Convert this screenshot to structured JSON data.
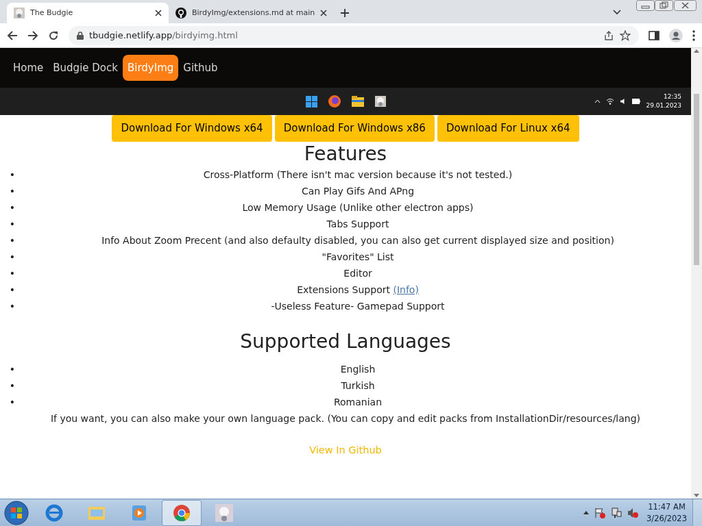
{
  "browser": {
    "tabs": [
      {
        "title": "The Budgie",
        "selected": true
      },
      {
        "title": "BirdyImg/extensions.md at main",
        "selected": false
      }
    ],
    "address": {
      "host": "tbudgie.netlify.app",
      "path": "/birdyimg.html"
    }
  },
  "page": {
    "nav": [
      {
        "label": "Home",
        "selected": false
      },
      {
        "label": "Budgie Dock",
        "selected": false
      },
      {
        "label": "BirdyImg",
        "selected": true
      },
      {
        "label": "Github",
        "selected": false
      }
    ],
    "hero_screenshot": {
      "clock_time": "12:35",
      "clock_date": "29.01.2023"
    },
    "downloads": [
      "Download For Windows x64",
      "Download For Windows x86",
      "Download For Linux x64"
    ],
    "features_heading": "Features",
    "features": [
      {
        "bullet": "•",
        "text": "Cross-Platform (There isn't mac version because it's not tested.)"
      },
      {
        "bullet": "•",
        "text": "Can Play Gifs And APng"
      },
      {
        "bullet": "•",
        "text": "Low Memory Usage (Unlike other electron apps)"
      },
      {
        "bullet": "•",
        "text": "Tabs Support"
      },
      {
        "bullet": "•",
        "text": "Info About Zoom Precent (and also defaulty disabled, you can also get current displayed size and position)"
      },
      {
        "bullet": "•",
        "text": "\"Favorites\" List"
      },
      {
        "bullet": "•",
        "text": "Editor"
      },
      {
        "bullet": "•",
        "text": "Extensions Support",
        "link": "(Info)"
      },
      {
        "bullet": "•",
        "text": "-Useless Feature- Gamepad Support"
      }
    ],
    "languages_heading": "Supported Languages",
    "languages": [
      {
        "bullet": "•",
        "text": "English"
      },
      {
        "bullet": "•",
        "text": "Turkish"
      },
      {
        "bullet": "•",
        "text": "Romanian"
      }
    ],
    "language_note": "If you want, you can also make your own language pack. (You can copy and edit packs from InstallationDir/resources/lang)",
    "github_link": "View In Github"
  },
  "taskbar": {
    "apps": [
      {
        "selected": false
      },
      {
        "selected": false
      },
      {
        "selected": false
      },
      {
        "selected": true
      },
      {
        "selected": false
      }
    ],
    "clock_time": "11:47 AM",
    "clock_date": "3/26/2023"
  }
}
